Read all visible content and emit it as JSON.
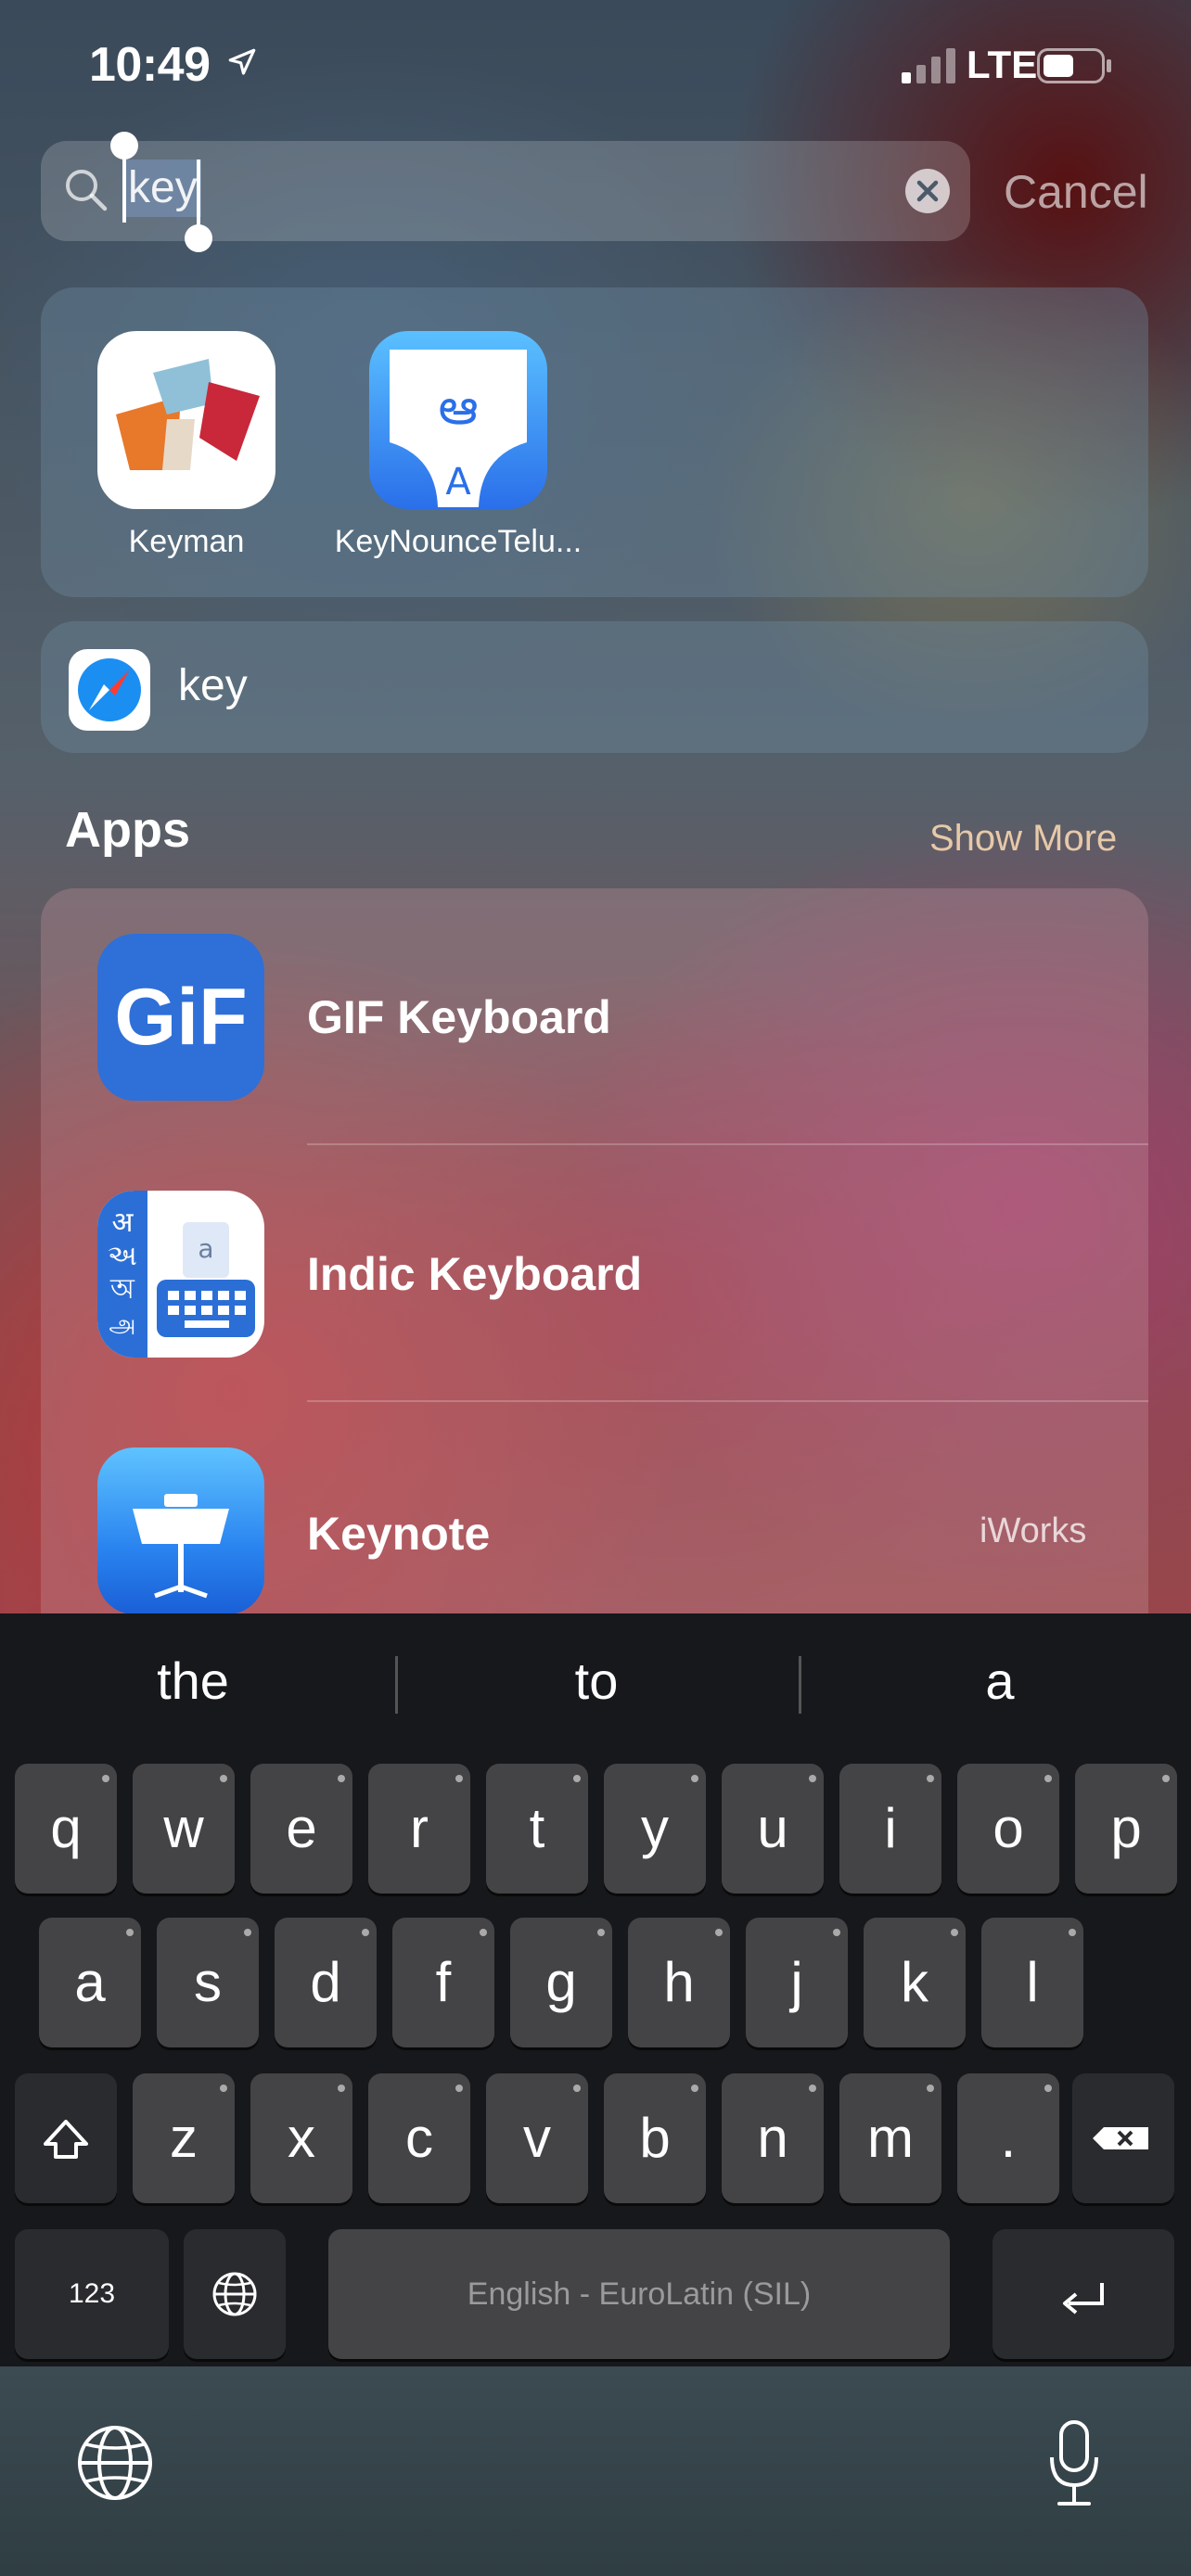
{
  "status_bar": {
    "time": "10:49",
    "network": "LTE"
  },
  "search": {
    "query": "key",
    "cancel_label": "Cancel"
  },
  "top_hits": [
    {
      "name": "Keyman",
      "icon": "keyman-app-icon"
    },
    {
      "name": "KeyNounceTelu...",
      "icon": "keynounce-telugu-app-icon"
    }
  ],
  "web_suggestion": {
    "text": "key",
    "icon": "safari-icon"
  },
  "apps_section": {
    "heading": "Apps",
    "show_more_label": "Show More",
    "items": [
      {
        "name": "GIF Keyboard",
        "icon": "gif-keyboard-app-icon",
        "meta": "",
        "icon_text": "GiF"
      },
      {
        "name": "Indic Keyboard",
        "icon": "indic-keyboard-app-icon",
        "meta": ""
      },
      {
        "name": "Keynote",
        "icon": "keynote-app-icon",
        "meta": "iWorks"
      }
    ]
  },
  "keyboard": {
    "predictions": [
      "the",
      "to",
      "a"
    ],
    "row1": [
      "q",
      "w",
      "e",
      "r",
      "t",
      "y",
      "u",
      "i",
      "o",
      "p"
    ],
    "row2": [
      "a",
      "s",
      "d",
      "f",
      "g",
      "h",
      "j",
      "k",
      "l"
    ],
    "row3": [
      "z",
      "x",
      "c",
      "v",
      "b",
      "n",
      "m",
      "."
    ],
    "numbers_key": "123",
    "space_label": "English - EuroLatin (SIL)"
  },
  "colors": {
    "key_bg": "#444446",
    "keyboard_bg": "#16181b",
    "gif_blue": "#2f6fd8",
    "keynote_blue": "#2a84f0"
  }
}
